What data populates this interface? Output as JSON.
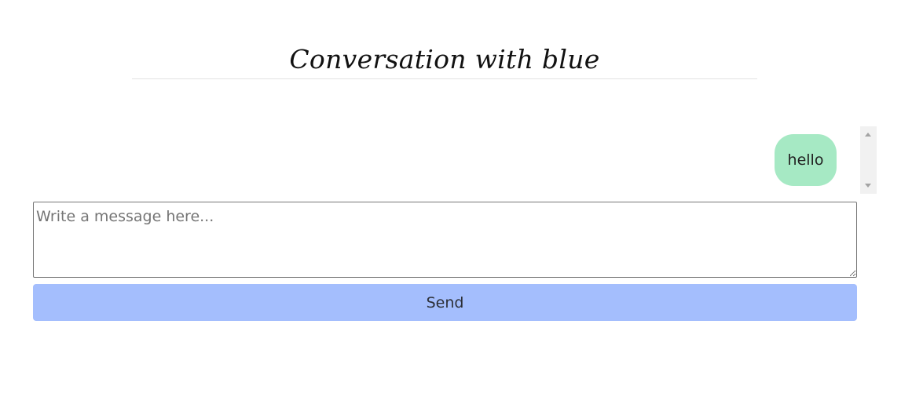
{
  "header": {
    "title": "Conversation with blue"
  },
  "messages": [
    {
      "text": "hello",
      "color": "#a6e9c4"
    }
  ],
  "composer": {
    "placeholder": "Write a message here...",
    "value": ""
  },
  "actions": {
    "send_label": "Send",
    "send_color": "#a4befd"
  }
}
